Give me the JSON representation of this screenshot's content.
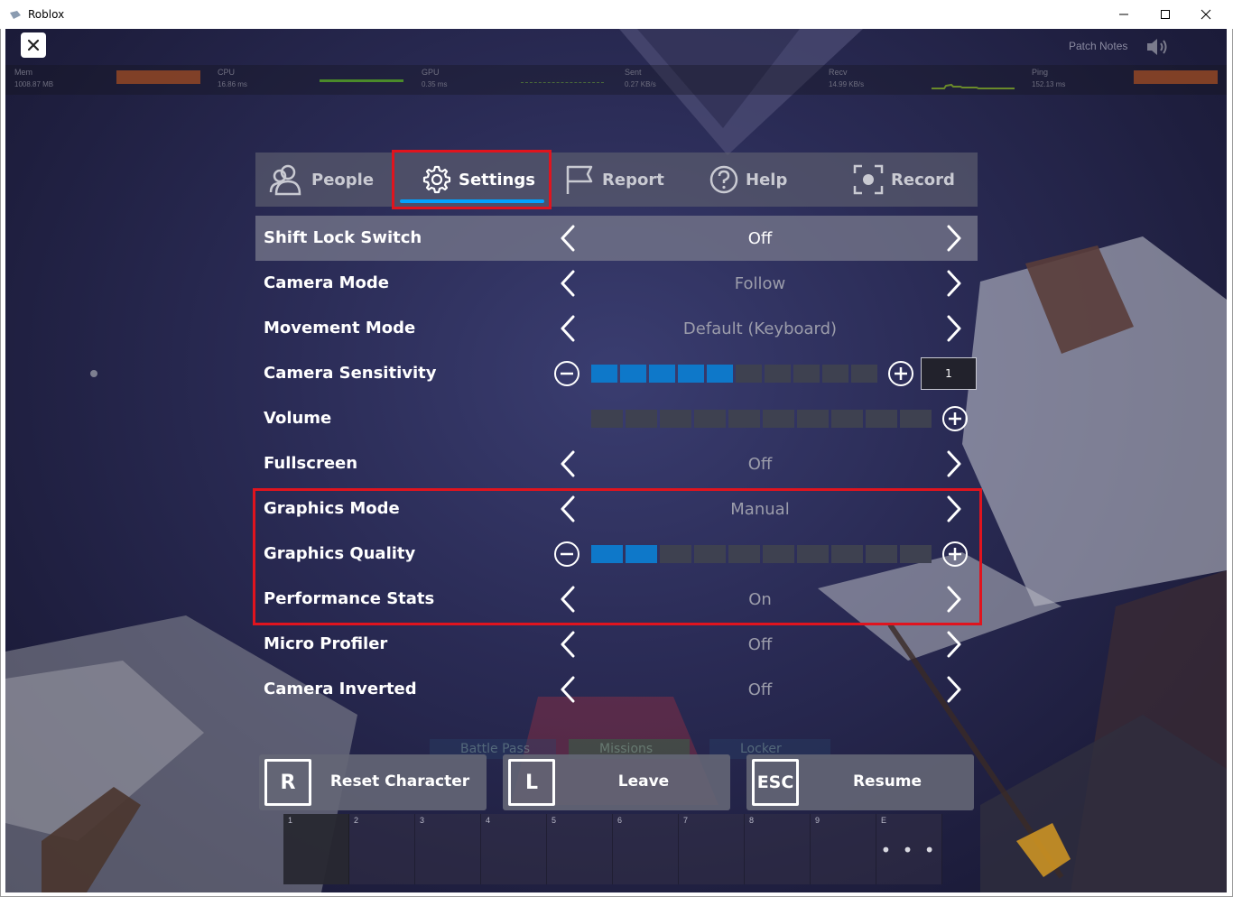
{
  "window": {
    "title": "Roblox",
    "controls": {
      "minimize": "minimize-icon",
      "maximize": "maximize-icon",
      "close": "close-icon"
    }
  },
  "top_right": {
    "patch_notes": "Patch Notes"
  },
  "stats": [
    {
      "label": "Mem",
      "value": "1008.87 MB"
    },
    {
      "label": "CPU",
      "value": "16.86 ms"
    },
    {
      "label": "GPU",
      "value": "0.35 ms"
    },
    {
      "label": "Sent",
      "value": "0.27 KB/s"
    },
    {
      "label": "Recv",
      "value": "14.99 KB/s"
    },
    {
      "label": "Ping",
      "value": "152.13 ms"
    }
  ],
  "tabs": [
    {
      "label": "People",
      "icon": "people-icon"
    },
    {
      "label": "Settings",
      "icon": "gear-icon",
      "active": true
    },
    {
      "label": "Report",
      "icon": "flag-icon"
    },
    {
      "label": "Help",
      "icon": "help-icon"
    },
    {
      "label": "Record",
      "icon": "record-icon"
    }
  ],
  "settings": {
    "shift_lock": {
      "label": "Shift Lock Switch",
      "value": "Off"
    },
    "camera_mode": {
      "label": "Camera Mode",
      "value": "Follow"
    },
    "movement_mode": {
      "label": "Movement Mode",
      "value": "Default (Keyboard)"
    },
    "camera_sensitivity": {
      "label": "Camera Sensitivity",
      "level": 5,
      "steps": 10,
      "value": "1"
    },
    "volume": {
      "label": "Volume",
      "level": 0,
      "steps": 10
    },
    "fullscreen": {
      "label": "Fullscreen",
      "value": "Off"
    },
    "graphics_mode": {
      "label": "Graphics Mode",
      "value": "Manual"
    },
    "graphics_quality": {
      "label": "Graphics Quality",
      "level": 2,
      "steps": 10
    },
    "performance_stats": {
      "label": "Performance Stats",
      "value": "On"
    },
    "micro_profiler": {
      "label": "Micro Profiler",
      "value": "Off"
    },
    "camera_inverted": {
      "label": "Camera Inverted",
      "value": "Off"
    }
  },
  "background_menu": {
    "battle_pass": "Battle Pass",
    "missions": "Missions",
    "locker": "Locker"
  },
  "actions": [
    {
      "key": "R",
      "label": "Reset Character"
    },
    {
      "key": "L",
      "label": "Leave"
    },
    {
      "key": "ESC",
      "label": "Resume"
    }
  ],
  "hotbar": [
    "1",
    "2",
    "3",
    "4",
    "5",
    "6",
    "7",
    "8",
    "9",
    "E"
  ],
  "hotbar_more": "• • •",
  "colors": {
    "accent": "#00a2ff",
    "highlight": "#e0141e",
    "segment_on": "#0e78c9"
  }
}
